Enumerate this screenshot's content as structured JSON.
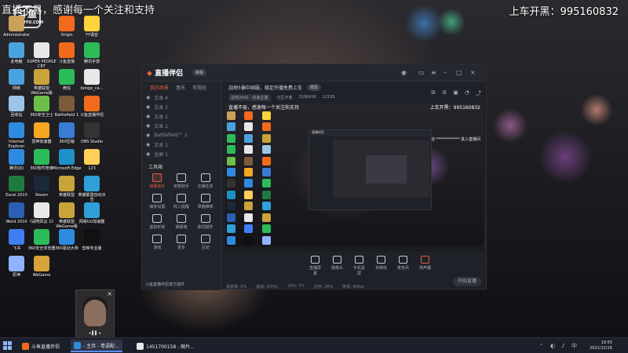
{
  "stream_overlay": {
    "scrolling_text": "直播不易，感谢每一个关注和支持",
    "car_label": "上车开黑：995160832",
    "douyu_logo": "斗鱼",
    "douyu_sub": "DOUYU.COM"
  },
  "desktop_icons": [
    {
      "label": "Administrator",
      "color": "#caa15b"
    },
    {
      "label": "Origin",
      "color": "#f26a1b"
    },
    {
      "label": "YY语音",
      "color": "#ffd33a"
    },
    {
      "label": "此电脑",
      "color": "#4aa3df"
    },
    {
      "label": "SUPER PEOPLE CBT",
      "color": "#e8e8e8"
    },
    {
      "label": "斗鱼直播",
      "color": "#f26a1b"
    },
    {
      "label": "腾讯手游",
      "color": "#2dbb5a"
    },
    {
      "label": "网络",
      "color": "#4aa3df"
    },
    {
      "label": "英雄联盟 WeGame版",
      "color": "#c9a43a"
    },
    {
      "label": "微信",
      "color": "#2dbb5a"
    },
    {
      "label": "bongo_ca...",
      "color": "#e8e8e8"
    },
    {
      "label": "回收站",
      "color": "#9bc4e8"
    },
    {
      "label": "360安全卫士",
      "color": "#6cc04a"
    },
    {
      "label": "Battlefield 1",
      "color": "#7a5b3a"
    },
    {
      "label": "斗鱼直播伴侣",
      "color": "#f26a1b"
    },
    {
      "label": "Internet Explorer",
      "color": "#2f8be0"
    },
    {
      "label": "雷神加速器",
      "color": "#f5a623"
    },
    {
      "label": "360压缩",
      "color": "#3a7bd5"
    },
    {
      "label": "OBS Studio",
      "color": "#333"
    },
    {
      "label": "腾讯QQ",
      "color": "#2f8be0"
    },
    {
      "label": "360软件管家",
      "color": "#2dbb5a"
    },
    {
      "label": "Microsoft Edge",
      "color": "#1e90c8"
    },
    {
      "label": "123",
      "color": "#ffcf5a"
    },
    {
      "label": "Excel 2010",
      "color": "#1f7a3f"
    },
    {
      "label": "Steam",
      "color": "#1b2838"
    },
    {
      "label": "英雄联盟",
      "color": "#c9a43a"
    },
    {
      "label": "英雄联盟自动点击",
      "color": "#2fa0d8"
    },
    {
      "label": "Word 2010",
      "color": "#2b5fb4"
    },
    {
      "label": "《战地风云 1》",
      "color": "#e8e8e8"
    },
    {
      "label": "英雄联盟 WeGame版",
      "color": "#c9a43a"
    },
    {
      "label": "网易UU加速器",
      "color": "#2fa0d8"
    },
    {
      "label": "飞书",
      "color": "#3f7df5"
    },
    {
      "label": "360安全浏览器",
      "color": "#2dbb5a"
    },
    {
      "label": "360驱动大师",
      "color": "#2f8be0"
    },
    {
      "label": "剪映专业版",
      "color": "#111"
    },
    {
      "label": "原神",
      "color": "#8fb4ff"
    },
    {
      "label": "WeGame",
      "color": "#d7a33a"
    }
  ],
  "app": {
    "logo_main": "直播伴侣",
    "version_badge": "新版",
    "left_tabs": [
      "我的场景",
      "音乐",
      "可视化"
    ],
    "scenes": [
      "文本 4",
      "文本 3",
      "文本 2",
      "文本 1",
      "Battlefield™ 1",
      "文本 1",
      "全屏 1"
    ],
    "tools_header": "工具箱",
    "tools": [
      {
        "label": "弹幕助手",
        "active": true
      },
      {
        "label": "房管助手",
        "active": false
      },
      {
        "label": "主播任务",
        "active": false
      },
      {
        "label": "抽奖设置",
        "active": false
      },
      {
        "label": "收入提醒",
        "active": false
      },
      {
        "label": "录播推荐",
        "active": false
      },
      {
        "label": "虚拟形象",
        "active": false
      },
      {
        "label": "弹幕墙",
        "active": false
      },
      {
        "label": "歌词插件",
        "active": false
      },
      {
        "label": "游戏",
        "active": false
      },
      {
        "label": "更多",
        "active": false
      },
      {
        "label": "互动",
        "active": false
      }
    ],
    "plugin_text": "斗鱼直播伴侣官方插件",
    "announcement": "战地5偏中国服，稳定开播免费上车",
    "announcement_btn": "修改",
    "info_chips": [
      "战地2042 · 快速主播",
      "分区不变",
      "3106416",
      "12155"
    ],
    "preview_text": "直播不易，感谢每一个关注和支持",
    "preview_car": "上车开黑：995160832",
    "preview_welcome": "欢迎 ************ 进入直播间",
    "nested_title": "直播伴侣",
    "controls": [
      {
        "label": "直播屏幕",
        "active": false
      },
      {
        "label": "摄像头",
        "active": false
      },
      {
        "label": "手机投屏",
        "active": false
      },
      {
        "label": "多媒体",
        "active": false
      },
      {
        "label": "麦克风",
        "active": false
      },
      {
        "label": "扬声器",
        "active": true
      }
    ],
    "start_button": "开始直播",
    "status": [
      "丢帧率: 0%",
      "丢帧: 0(0%)",
      "CPU: 7%",
      "内存: 26%",
      "帧率: 60fps"
    ]
  },
  "webcam": {
    "close": "×"
  },
  "taskbar": {
    "tasks": [
      {
        "label": "斗鱼直播伴侣",
        "color": "#f26a1b",
        "active": false
      },
      {
        "label": "- 主页 - 粤语配...",
        "color": "#2f8be0",
        "active": true
      },
      {
        "label": "1451700158 - 图片...",
        "color": "#e8e8e8",
        "active": false
      }
    ],
    "time": "19:55",
    "date": "2021/12/16"
  }
}
